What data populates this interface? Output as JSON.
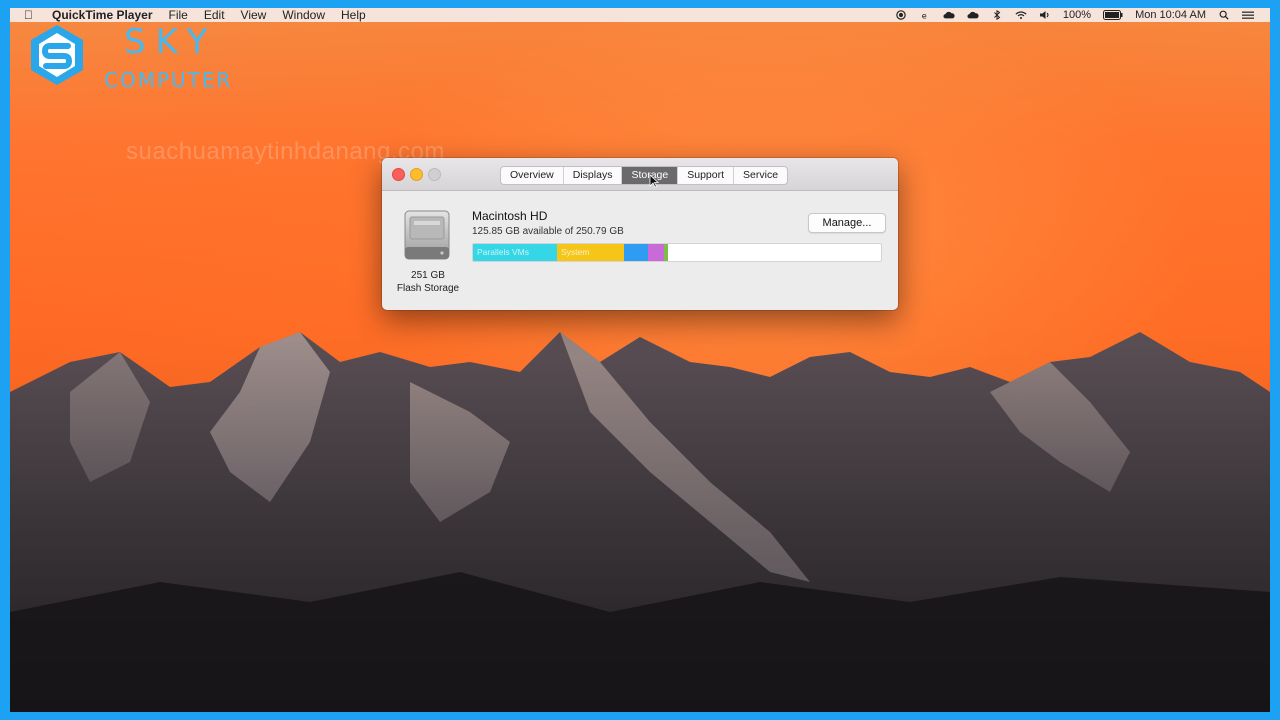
{
  "menubar": {
    "app_name": "QuickTime Player",
    "items": [
      "File",
      "Edit",
      "View",
      "Window",
      "Help"
    ],
    "battery": "100%",
    "clock": "Mon 10:04 AM"
  },
  "logo": {
    "brand": "SKY",
    "sub": "COMPUTER"
  },
  "watermark": "suachuamaytinhdanang.com",
  "window": {
    "tabs": [
      "Overview",
      "Displays",
      "Storage",
      "Support",
      "Service"
    ],
    "active_tab": "Storage",
    "disk": {
      "name": "Macintosh HD",
      "available": "125.85 GB available of 250.79 GB",
      "capacity": "251 GB",
      "type": "Flash Storage"
    },
    "manage_label": "Manage...",
    "storage_segments": [
      {
        "label": "Parallels VMs",
        "color": "#35d6e5",
        "fraction": 0.205
      },
      {
        "label": "System",
        "color": "#f5c518",
        "fraction": 0.165
      },
      {
        "label": "",
        "color": "#2f9cf4",
        "fraction": 0.06
      },
      {
        "label": "",
        "color": "#c86ad8",
        "fraction": 0.04
      },
      {
        "label": "",
        "color": "#7bbf4a",
        "fraction": 0.008
      }
    ]
  }
}
